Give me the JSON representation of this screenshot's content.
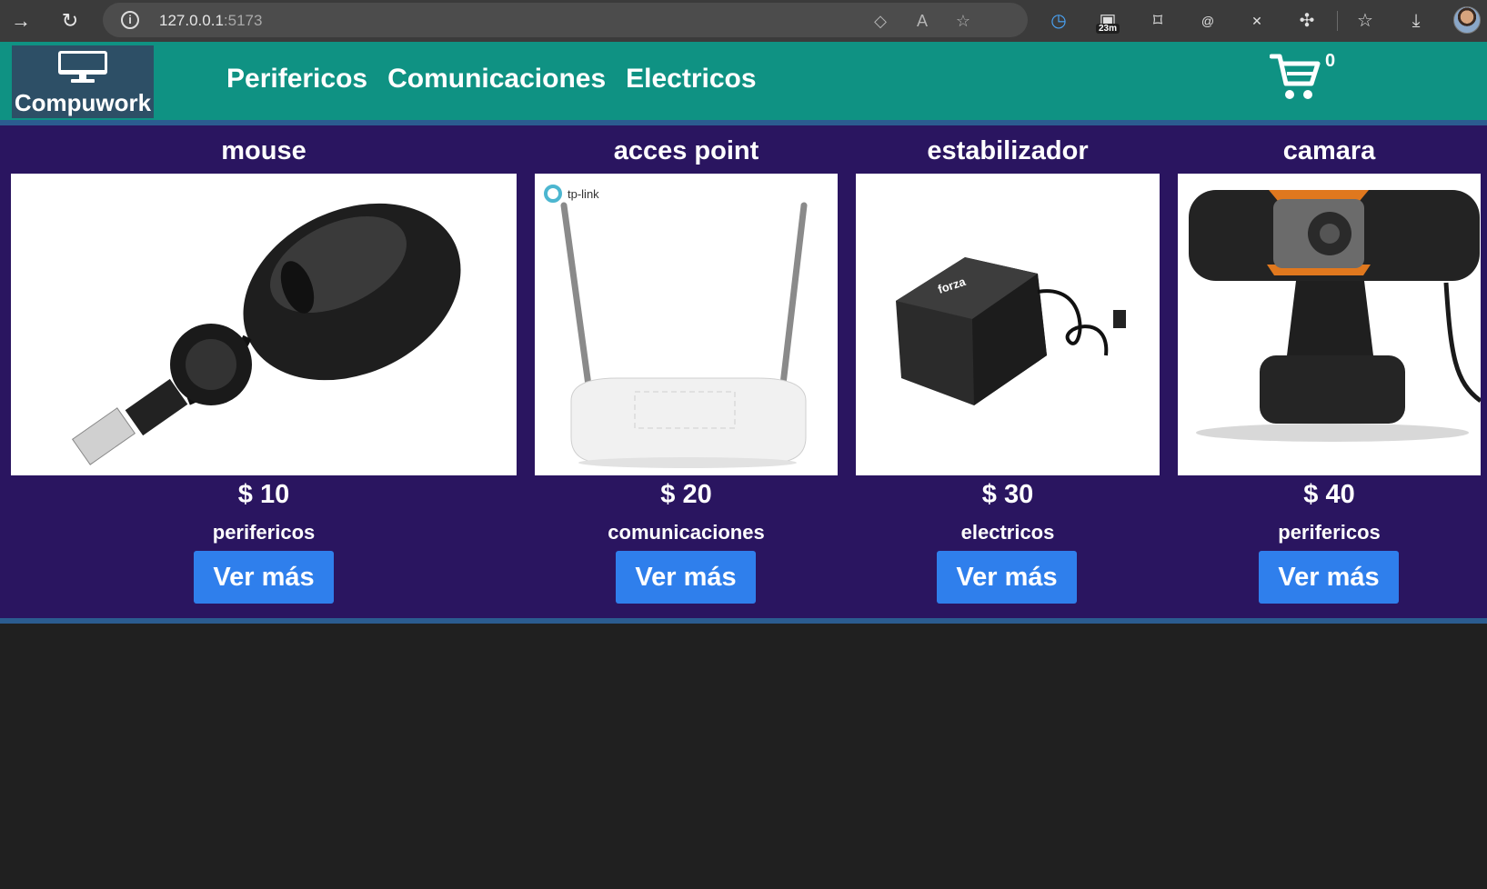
{
  "browser": {
    "url_host": "127.0.0.1",
    "url_port": ":5173",
    "extension_badge": "23m"
  },
  "header": {
    "brand": "Compuwork",
    "nav": [
      "Perifericos",
      "Comunicaciones",
      "Electricos"
    ],
    "cart_count": "0"
  },
  "products": [
    {
      "name": "mouse",
      "price": "$ 10",
      "category": "perifericos",
      "button": "Ver más"
    },
    {
      "name": "acces point",
      "price": "$ 20",
      "category": "comunicaciones",
      "button": "Ver más",
      "image_logo": "tp-link"
    },
    {
      "name": "estabilizador",
      "price": "$ 30",
      "category": "electricos",
      "button": "Ver más",
      "image_logo": "forza"
    },
    {
      "name": "camara",
      "price": "$ 40",
      "category": "perifericos",
      "button": "Ver más"
    }
  ],
  "colors": {
    "header_bg": "#0f9283",
    "products_bg": "#2a1560",
    "button_bg": "#2f7fec",
    "strip": "#2b5c90",
    "page_bg": "#202020"
  }
}
